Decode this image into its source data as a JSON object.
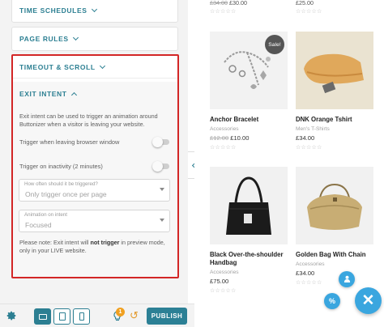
{
  "settings": {
    "sections": [
      {
        "label": "TIME SCHEDULES"
      },
      {
        "label": "PAGE RULES"
      },
      {
        "label": "TIMEOUT & SCROLL"
      }
    ],
    "exit_intent": {
      "title": "EXIT INTENT",
      "description": "Exit intent can be used to trigger an animation around Buttonizer when a visitor is leaving your website.",
      "trigger_leaving_label": "Trigger when leaving browser window",
      "trigger_leaving_enabled": false,
      "trigger_inactivity_label": "Trigger on inactivity (2 minutes)",
      "trigger_inactivity_enabled": false,
      "frequency_label": "How often should it be triggered?",
      "frequency_value": "Only trigger once per page",
      "animation_label": "Animation on intent",
      "animation_value": "Focused",
      "note_prefix": "Please note: Exit intent will ",
      "note_bold": "not trigger",
      "note_suffix": " in preview mode, only in your LIVE website."
    }
  },
  "toolbar": {
    "settings_icon": "gear-icon",
    "devices": [
      {
        "name": "desktop",
        "active": true
      },
      {
        "name": "tablet",
        "active": false
      },
      {
        "name": "mobile",
        "active": false
      }
    ],
    "notification_count": "1",
    "publish_label": "PUBLISH"
  },
  "shop": {
    "top_row": [
      {
        "price_old": "£34.00",
        "price": "£30.00"
      },
      {
        "price": "£25.00"
      }
    ],
    "products": [
      {
        "name": "Anchor Bracelet",
        "category": "Accessories",
        "price_old": "£12.00",
        "price": "£10.00",
        "sale": "Sale!"
      },
      {
        "name": "DNK Orange Tshirt",
        "category": "Men's T-Shirts",
        "price": "£34.00"
      },
      {
        "name": "Black Over-the-shoulder Handbag",
        "category": "Accessories",
        "price": "£75.00"
      },
      {
        "name": "Golden Bag With Chain",
        "category": "Accessories",
        "price": "£34.00"
      }
    ],
    "rating_stars": "☆☆☆☆☆"
  },
  "colors": {
    "accent": "#2c7f92",
    "highlight_border": "#d32626",
    "fab": "#3aa6df",
    "badge": "#f0a020"
  }
}
